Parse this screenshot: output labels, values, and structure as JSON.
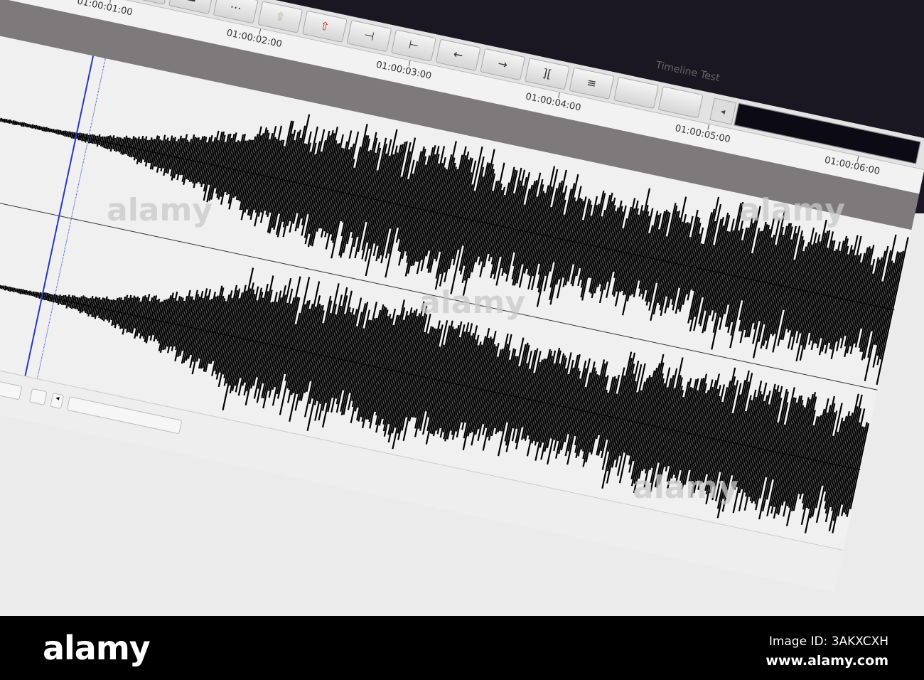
{
  "window": {
    "title": "Timeline Test"
  },
  "toolbar": {
    "buttons": [
      {
        "name": "mark-in",
        "glyph": "["
      },
      {
        "name": "mark-clip",
        "glyph": "]["
      },
      {
        "name": "mark-clip-alt",
        "glyph": "▐▌"
      },
      {
        "name": "clear-marks",
        "glyph": "▬"
      },
      {
        "name": "split",
        "glyph": "⋯"
      },
      {
        "name": "lift",
        "glyph": "⇧"
      },
      {
        "name": "extract",
        "glyph": "⇧"
      },
      {
        "name": "trim-in",
        "glyph": "⊣"
      },
      {
        "name": "trim-out",
        "glyph": "⊢"
      },
      {
        "name": "nudge-left",
        "glyph": "←"
      },
      {
        "name": "nudge-right",
        "glyph": "→"
      },
      {
        "name": "match-frame",
        "glyph": "]["
      },
      {
        "name": "menu",
        "glyph": "≡"
      },
      {
        "name": "blank1",
        "glyph": ""
      },
      {
        "name": "blank2",
        "glyph": ""
      }
    ],
    "colors": {
      "extract_arrow": "#e0201a",
      "lift_arrow": "#f3eec0"
    },
    "readout_left_glyph": "◂",
    "readout_right_glyph": "▥"
  },
  "ruler": {
    "timecodes": [
      "01:00:01:00",
      "01:00:02:00",
      "01:00:03:00",
      "01:00:04:00",
      "01:00:05:00",
      "01:00:06:00"
    ]
  },
  "bottom": {
    "scroll_left_glyph": "◂"
  },
  "watermark": {
    "text": "alamy",
    "small": "a"
  },
  "banner": {
    "logo": "alamy",
    "image_id": "Image ID: 3AKXCXH",
    "url": "www.alamy.com"
  }
}
